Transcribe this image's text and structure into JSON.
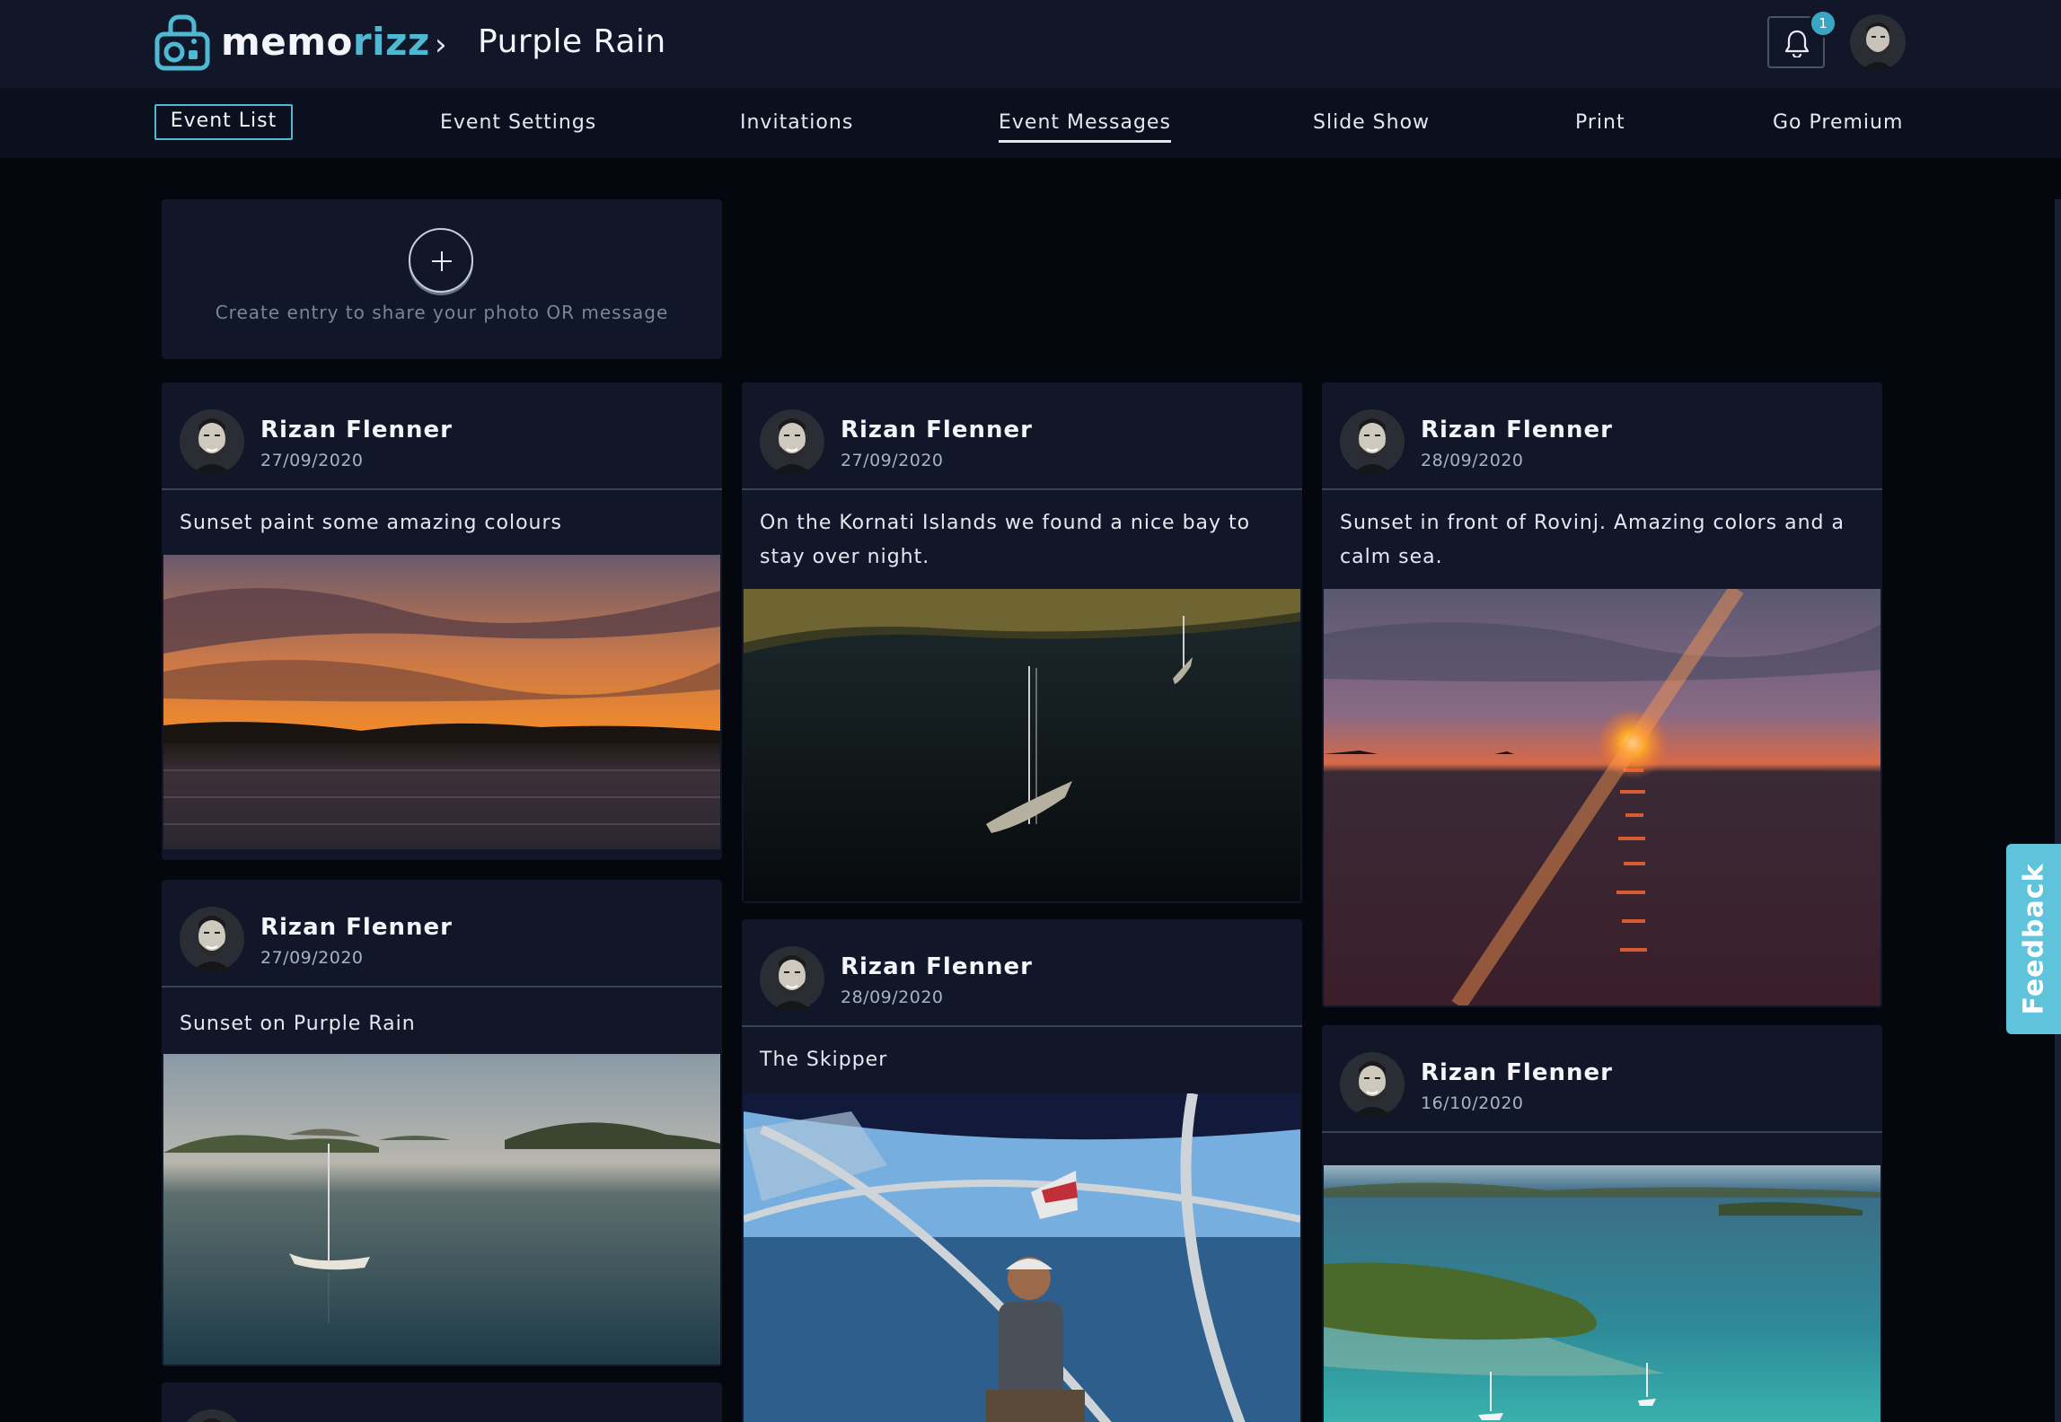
{
  "header": {
    "brand_main": "memo",
    "brand_accent": "rizz",
    "breadcrumb_sep": "›",
    "page_title": "Purple Rain",
    "notification_count": "1",
    "icons": {
      "logo": "lock-camera-logo",
      "bell": "bell-icon",
      "avatar": "user-avatar"
    },
    "colors": {
      "accent": "#4fb9d3",
      "header_bg": "#111729",
      "page_bg": "#05070e"
    }
  },
  "nav": {
    "event_list": "Event List",
    "event_settings": "Event Settings",
    "invitations": "Invitations",
    "event_messages": "Event Messages",
    "slide_show": "Slide Show",
    "print": "Print",
    "go_premium": "Go Premium"
  },
  "create": {
    "prompt": "Create entry to share your photo OR message"
  },
  "posts": [
    {
      "author": "Rizan Flenner",
      "date": "27/09/2020",
      "text": "Sunset paint some amazing colours",
      "photo": "sunset-clouds-photo"
    },
    {
      "author": "Rizan Flenner",
      "date": "27/09/2020",
      "text": "On the Kornati Islands we found a nice bay to stay over night.",
      "photo": "sailboat-bay-aerial-photo"
    },
    {
      "author": "Rizan Flenner",
      "date": "28/09/2020",
      "text": "Sunset in front of Rovinj. Amazing colors and a calm sea.",
      "photo": "sunset-sea-photo"
    },
    {
      "author": "Rizan Flenner",
      "date": "27/09/2020",
      "text": "Sunset on Purple Rain",
      "photo": "sailboat-islands-photo"
    },
    {
      "author": "Rizan Flenner",
      "date": "28/09/2020",
      "text": "The Skipper",
      "photo": "skipper-photo"
    },
    {
      "author": "Rizan Flenner",
      "date": "16/10/2020",
      "text": "",
      "photo": "island-aerial-photo"
    }
  ],
  "feedback": {
    "label": "Feedback"
  }
}
